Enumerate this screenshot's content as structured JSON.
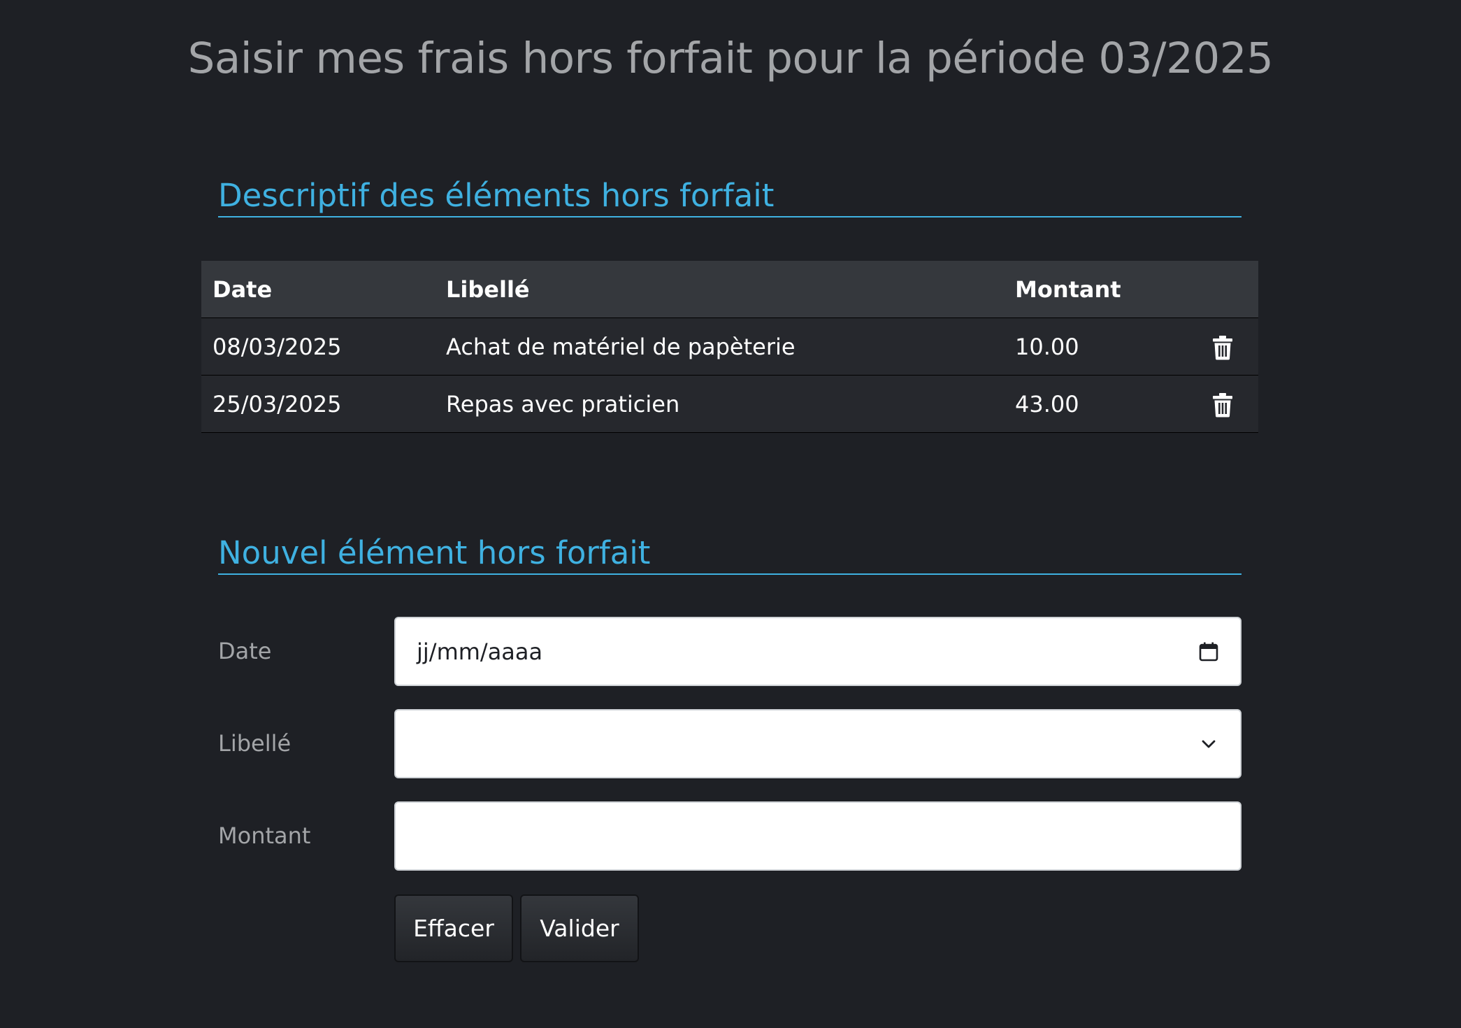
{
  "page": {
    "title": "Saisir mes frais hors forfait pour la période 03/2025"
  },
  "list_section": {
    "heading": "Descriptif des éléments hors forfait",
    "columns": {
      "date": "Date",
      "label": "Libellé",
      "amount": "Montant"
    },
    "rows": [
      {
        "date": "08/03/2025",
        "label": "Achat de matériel de papèterie",
        "amount": "10.00",
        "action_icon": "trash-icon"
      },
      {
        "date": "25/03/2025",
        "label": "Repas avec praticien",
        "amount": "43.00",
        "action_icon": "trash-icon"
      }
    ]
  },
  "form_section": {
    "heading": "Nouvel élément hors forfait",
    "date": {
      "label": "Date",
      "placeholder": "jj/mm/aaaa",
      "icon": "calendar-icon"
    },
    "label_field": {
      "label": "Libellé",
      "selected_value": "",
      "icon": "chevron-down-icon"
    },
    "amount": {
      "label": "Montant",
      "value": ""
    },
    "buttons": {
      "clear": "Effacer",
      "submit": "Valider"
    }
  },
  "colors": {
    "background": "#1e2025",
    "accent": "#3fb1e1",
    "title_text": "#a3a5a8",
    "table_header": "#35383d",
    "table_row": "#26282d"
  }
}
